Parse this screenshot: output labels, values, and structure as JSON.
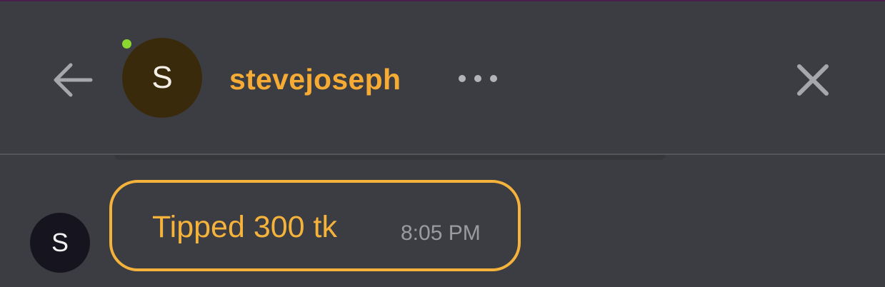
{
  "header": {
    "username": "stevejoseph",
    "avatar_initial": "S",
    "online": true,
    "icons": {
      "back": "arrow-left-icon",
      "more": "more-horizontal-icon",
      "close": "close-icon"
    }
  },
  "messages": [
    {
      "avatar_initial": "S",
      "text": "Tipped 300 tk",
      "time": "8:05 PM"
    }
  ],
  "colors": {
    "background": "#3c3d42",
    "accent": "#f6ac34",
    "online": "#8bd631",
    "avatar_bg": "#3a2a0c",
    "timestamp": "#9a9ba0"
  }
}
